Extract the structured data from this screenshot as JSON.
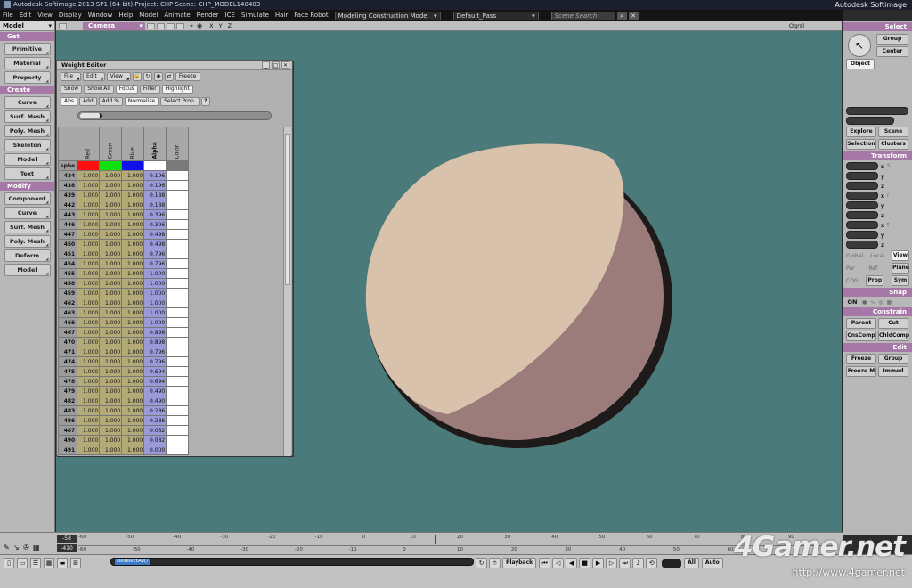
{
  "app": {
    "title": "Autodesk Softimage 2013 SP1 (64-bit)    Project: CHP    Scene: CHP_MODEL140403",
    "brand": "Autodesk Softimage"
  },
  "menu": {
    "items": [
      "File",
      "Edit",
      "View",
      "Display",
      "Window",
      "Help",
      "Model",
      "Animate",
      "Render",
      "ICE",
      "Simulate",
      "Hair",
      "Face Robot"
    ],
    "construction_mode": "Modeling Construction Mode",
    "pass": "Default_Pass",
    "search_placeholder": "Scene Search"
  },
  "left_panel": {
    "mode": "Model",
    "sections": [
      {
        "label": "Get",
        "buttons": [
          "Primitive",
          "Material",
          "Property"
        ]
      },
      {
        "label": "Create",
        "buttons": [
          "Curve",
          "Surf. Mesh",
          "Poly. Mesh",
          "Skeleton",
          "Model",
          "Text"
        ]
      },
      {
        "label": "Modify",
        "buttons": [
          "Component",
          "Curve",
          "Surf. Mesh",
          "Poly. Mesh",
          "Deform",
          "Model"
        ]
      }
    ]
  },
  "viewport": {
    "camera": "Camera",
    "axes": "X Y Z",
    "view_mode": "Ogrsl",
    "bg_color": "#4a7a79",
    "sphere_light": "#d9c2ab",
    "sphere_shade": "#9c7b7b",
    "sphere_edge": "#1e1a1a"
  },
  "weight_editor": {
    "title": "Weight Editor",
    "menus": [
      "File",
      "Edit",
      "View"
    ],
    "freeze_label": "Freeze",
    "row2": [
      "Show",
      "Show All",
      "Focus",
      "Filter",
      "Highlight"
    ],
    "row3": [
      "Abs",
      "Add",
      "Add %",
      "Normalize",
      "Select Prop."
    ],
    "help": "?",
    "columns": [
      "Red",
      "Green",
      "Blue",
      "Alpha",
      "Color"
    ],
    "swatch_row_label": "sphe",
    "swatch_colors": [
      "#ff1010",
      "#10e010",
      "#1010e8",
      "#ffffff",
      "#7a7a7a"
    ],
    "rows": [
      {
        "id": "434",
        "r": "1.000",
        "g": "1.000",
        "b": "1.000",
        "a": "0.196"
      },
      {
        "id": "438",
        "r": "1.000",
        "g": "1.000",
        "b": "1.000",
        "a": "0.196"
      },
      {
        "id": "439",
        "r": "1.000",
        "g": "1.000",
        "b": "1.000",
        "a": "0.188"
      },
      {
        "id": "442",
        "r": "1.000",
        "g": "1.000",
        "b": "1.000",
        "a": "0.188"
      },
      {
        "id": "443",
        "r": "1.000",
        "g": "1.000",
        "b": "1.000",
        "a": "0.396"
      },
      {
        "id": "446",
        "r": "1.000",
        "g": "1.000",
        "b": "1.000",
        "a": "0.396"
      },
      {
        "id": "447",
        "r": "1.000",
        "g": "1.000",
        "b": "1.000",
        "a": "0.498"
      },
      {
        "id": "450",
        "r": "1.000",
        "g": "1.000",
        "b": "1.000",
        "a": "0.498"
      },
      {
        "id": "451",
        "r": "1.000",
        "g": "1.000",
        "b": "1.000",
        "a": "0.796"
      },
      {
        "id": "454",
        "r": "1.000",
        "g": "1.000",
        "b": "1.000",
        "a": "0.796"
      },
      {
        "id": "455",
        "r": "1.000",
        "g": "1.000",
        "b": "1.000",
        "a": "1.000"
      },
      {
        "id": "458",
        "r": "1.000",
        "g": "1.000",
        "b": "1.000",
        "a": "1.000"
      },
      {
        "id": "459",
        "r": "1.000",
        "g": "1.000",
        "b": "1.000",
        "a": "1.000"
      },
      {
        "id": "462",
        "r": "1.000",
        "g": "1.000",
        "b": "1.000",
        "a": "1.000"
      },
      {
        "id": "463",
        "r": "1.000",
        "g": "1.000",
        "b": "1.000",
        "a": "1.000"
      },
      {
        "id": "466",
        "r": "1.000",
        "g": "1.000",
        "b": "1.000",
        "a": "1.000"
      },
      {
        "id": "467",
        "r": "1.000",
        "g": "1.000",
        "b": "1.000",
        "a": "0.898"
      },
      {
        "id": "470",
        "r": "1.000",
        "g": "1.000",
        "b": "1.000",
        "a": "0.898"
      },
      {
        "id": "471",
        "r": "1.000",
        "g": "1.000",
        "b": "1.000",
        "a": "0.796"
      },
      {
        "id": "474",
        "r": "1.000",
        "g": "1.000",
        "b": "1.000",
        "a": "0.796"
      },
      {
        "id": "475",
        "r": "1.000",
        "g": "1.000",
        "b": "1.000",
        "a": "0.694"
      },
      {
        "id": "478",
        "r": "1.000",
        "g": "1.000",
        "b": "1.000",
        "a": "0.694"
      },
      {
        "id": "479",
        "r": "1.000",
        "g": "1.000",
        "b": "1.000",
        "a": "0.490"
      },
      {
        "id": "482",
        "r": "1.000",
        "g": "1.000",
        "b": "1.000",
        "a": "0.490"
      },
      {
        "id": "483",
        "r": "1.000",
        "g": "1.000",
        "b": "1.000",
        "a": "0.286"
      },
      {
        "id": "486",
        "r": "1.000",
        "g": "1.000",
        "b": "1.000",
        "a": "0.286"
      },
      {
        "id": "487",
        "r": "1.000",
        "g": "1.000",
        "b": "1.000",
        "a": "0.082"
      },
      {
        "id": "490",
        "r": "1.000",
        "g": "1.000",
        "b": "1.000",
        "a": "0.082"
      },
      {
        "id": "491",
        "r": "1.000",
        "g": "1.000",
        "b": "1.000",
        "a": "0.000"
      }
    ]
  },
  "right_panel": {
    "select_header": "Select",
    "group": "Group",
    "center": "Center",
    "object": "Object",
    "explore": "Explore",
    "scene": "Scene",
    "selection": "Selection",
    "clusters": "Clusters",
    "transform_header": "Transform",
    "axes": [
      "x",
      "y",
      "z"
    ],
    "global": "Global",
    "local": "Local",
    "view": "View",
    "par": "Par",
    "ref": "Ref",
    "plane": "Plane",
    "cog": "COG",
    "prop": "Prop",
    "sym": "Sym",
    "snap_header": "Snap",
    "on": "ON",
    "constrain_header": "Constrain",
    "parent": "Parent",
    "cut": "Cut",
    "cnscomp": "CnsComp",
    "chldcomp": "ChldComp",
    "edit_header": "Edit",
    "freeze": "Freeze",
    "egroup": "Group",
    "freeze_m": "Freeze M",
    "immed": "Immed"
  },
  "timeline": {
    "start": "-58",
    "end": "-410",
    "ticks": [
      "-60",
      "-50",
      "-40",
      "-30",
      "-20",
      "-10",
      "0",
      "10",
      "20",
      "30",
      "40",
      "50",
      "60",
      "70",
      "80",
      "90"
    ],
    "sub_ticks": [
      "-60",
      "-50",
      "-40",
      "-30",
      "-20",
      "-10",
      "0",
      "10",
      "20",
      "30",
      "40",
      "50",
      "60",
      "70"
    ]
  },
  "bottom": {
    "command_tag": "DeselectAll()",
    "playback": "Playback",
    "all": "All",
    "auto": "Auto"
  },
  "watermark": {
    "logo": "4Gamer.net",
    "url": "http://www.4gamer.net"
  }
}
